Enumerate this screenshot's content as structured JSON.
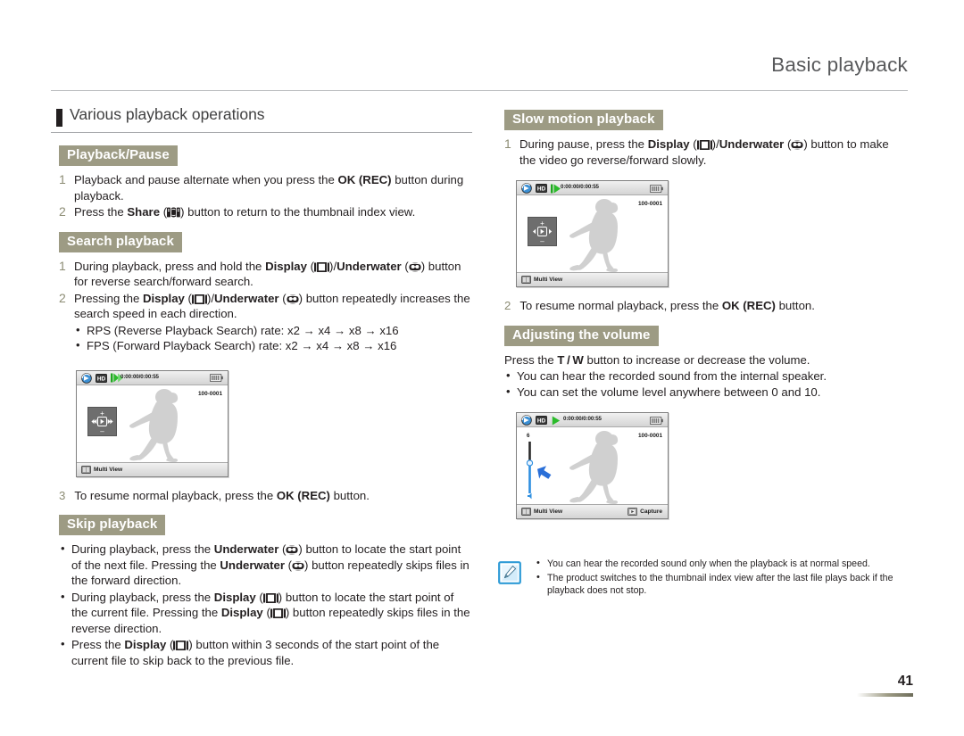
{
  "header": {
    "title": "Basic playback"
  },
  "chapter": {
    "title": "Various playback operations"
  },
  "left": {
    "playback_pause": {
      "heading": "Playback/Pause",
      "steps": [
        {
          "num": "1",
          "parts": [
            {
              "t": "Playback and pause alternate when you press the "
            },
            {
              "t": "OK (REC)",
              "b": true
            },
            {
              "t": " button during playback."
            }
          ]
        },
        {
          "num": "2",
          "parts": [
            {
              "t": "Press the "
            },
            {
              "t": "Share",
              "b": true
            },
            {
              "t": " ("
            },
            {
              "icon": "share-icon"
            },
            {
              "t": ") button to return to the thumbnail index view."
            }
          ]
        }
      ]
    },
    "search_playback": {
      "heading": "Search playback",
      "steps": [
        {
          "num": "1",
          "parts": [
            {
              "t": "During playback, press and hold the "
            },
            {
              "t": "Display",
              "b": true
            },
            {
              "t": " ("
            },
            {
              "icon": "display-icon"
            },
            {
              "t": ")/"
            },
            {
              "t": "Underwater",
              "b": true
            },
            {
              "t": " ("
            },
            {
              "icon": "underwater-icon"
            },
            {
              "t": ") button for reverse search/forward search."
            }
          ]
        },
        {
          "num": "2",
          "parts": [
            {
              "t": "Pressing the "
            },
            {
              "t": "Display",
              "b": true
            },
            {
              "t": " ("
            },
            {
              "icon": "display-icon"
            },
            {
              "t": ")/"
            },
            {
              "t": "Underwater",
              "b": true
            },
            {
              "t": " ("
            },
            {
              "icon": "underwater-icon"
            },
            {
              "t": ") button repeatedly increases the search speed in each direction."
            }
          ]
        }
      ],
      "sub_bullets": [
        "RPS (Reverse Playback Search) rate: x2 → x4 → x8 → x16",
        "FPS (Forward Playback Search) rate: x2 → x4 → x8 → x16"
      ],
      "step3": {
        "num": "3",
        "parts": [
          {
            "t": "To resume normal playback, press the "
          },
          {
            "t": "OK (REC)",
            "b": true
          },
          {
            "t": " button."
          }
        ]
      }
    },
    "skip_playback": {
      "heading": "Skip playback",
      "bullets": [
        {
          "parts": [
            {
              "t": "During playback, press the "
            },
            {
              "t": "Underwater",
              "b": true
            },
            {
              "t": " ("
            },
            {
              "icon": "underwater-icon"
            },
            {
              "t": ") button to locate the start point of the next file. Pressing the "
            },
            {
              "t": "Underwater",
              "b": true
            },
            {
              "t": " ("
            },
            {
              "icon": "underwater-icon"
            },
            {
              "t": ") button repeatedly skips files in the forward direction."
            }
          ]
        },
        {
          "parts": [
            {
              "t": "During playback, press the "
            },
            {
              "t": "Display",
              "b": true
            },
            {
              "t": " ("
            },
            {
              "icon": "display-icon"
            },
            {
              "t": ") button to locate the start point of the current file. Pressing the "
            },
            {
              "t": "Display",
              "b": true
            },
            {
              "t": " ("
            },
            {
              "icon": "display-icon"
            },
            {
              "t": ") button repeatedly skips files in the reverse direction."
            }
          ]
        },
        {
          "parts": [
            {
              "t": "Press the "
            },
            {
              "t": "Display",
              "b": true
            },
            {
              "t": " ("
            },
            {
              "icon": "display-icon"
            },
            {
              "t": ") button within 3 seconds of the start point of the current file to skip back to the previous file."
            }
          ]
        }
      ]
    }
  },
  "right": {
    "slow_motion": {
      "heading": "Slow motion playback",
      "step1": {
        "num": "1",
        "parts": [
          {
            "t": "During pause, press the "
          },
          {
            "t": "Display",
            "b": true
          },
          {
            "t": " ("
          },
          {
            "icon": "display-icon"
          },
          {
            "t": ")/"
          },
          {
            "t": "Underwater",
            "b": true
          },
          {
            "t": " ("
          },
          {
            "icon": "underwater-icon"
          },
          {
            "t": ") button to make the video go reverse/forward slowly."
          }
        ]
      },
      "step2": {
        "num": "2",
        "parts": [
          {
            "t": "To resume normal playback, press the "
          },
          {
            "t": "OK (REC)",
            "b": true
          },
          {
            "t": " button."
          }
        ]
      }
    },
    "volume": {
      "heading": "Adjusting the volume",
      "intro_parts": [
        {
          "t": "Press the "
        },
        {
          "t": "T / W",
          "b": true
        },
        {
          "t": " button to increase or decrease the volume."
        }
      ],
      "bullets": [
        "You can hear the recorded sound from the internal speaker.",
        "You can set the volume level anywhere between 0 and 10."
      ]
    },
    "note": {
      "icon": "note-pen-icon",
      "items": [
        "You can hear the recorded sound only when the playback is at normal speed.",
        "The product switches to the thumbnail index view after the last file plays back if the playback does not stop."
      ]
    }
  },
  "lcd_screens": {
    "search": {
      "time": "0:00:00/0:00:55",
      "file_no": "100-0001",
      "foot_left": "Multi View",
      "osd": "direction-pad"
    },
    "slow_motion": {
      "time": "0:00:00/0:00:55",
      "file_no": "100-0001",
      "foot_left": "Multi View",
      "osd": "direction-pad"
    },
    "volume": {
      "time": "0:00:00/0:00:55",
      "file_no": "100-0001",
      "foot_left": "Multi View",
      "foot_right": "Capture",
      "volume_level": "6",
      "osd": "volume-slider"
    }
  },
  "footer": {
    "page_number": "41"
  },
  "colors": {
    "sub_head_bg": "#9d9b84",
    "header_title": "#58595b",
    "step_number": "#8c8c74",
    "note_icon_border": "#2e9bd6",
    "accent_blue": "#1f6fd0"
  }
}
